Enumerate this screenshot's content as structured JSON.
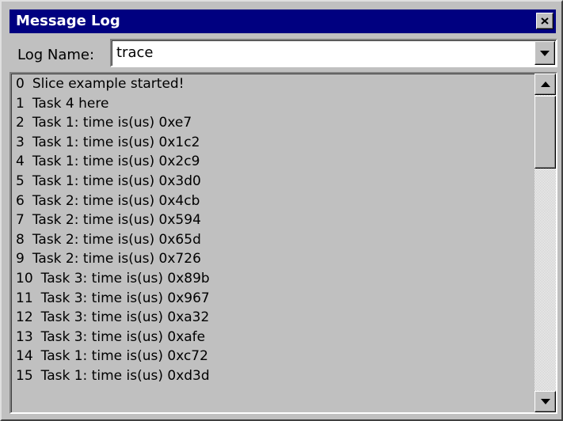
{
  "window": {
    "title": "Message Log"
  },
  "log_name": {
    "label": "Log Name:",
    "value": "trace"
  },
  "messages": [
    {
      "index": "0",
      "text": "Slice example started!"
    },
    {
      "index": "1",
      "text": "Task 4 here"
    },
    {
      "index": "2",
      "text": "Task 1: time is(us) 0xe7"
    },
    {
      "index": "3",
      "text": "Task 1: time is(us) 0x1c2"
    },
    {
      "index": "4",
      "text": "Task 1: time is(us) 0x2c9"
    },
    {
      "index": "5",
      "text": "Task 1: time is(us) 0x3d0"
    },
    {
      "index": "6",
      "text": "Task 2: time is(us) 0x4cb"
    },
    {
      "index": "7",
      "text": "Task 2: time is(us) 0x594"
    },
    {
      "index": "8",
      "text": "Task 2: time is(us) 0x65d"
    },
    {
      "index": "9",
      "text": "Task 2: time is(us) 0x726"
    },
    {
      "index": "10",
      "text": "Task 3: time is(us) 0x89b"
    },
    {
      "index": "11",
      "text": "Task 3: time is(us) 0x967"
    },
    {
      "index": "12",
      "text": "Task 3: time is(us) 0xa32"
    },
    {
      "index": "13",
      "text": "Task 3: time is(us) 0xafe"
    },
    {
      "index": "14",
      "text": "Task 1: time is(us) 0xc72"
    },
    {
      "index": "15",
      "text": "Task 1: time is(us) 0xd3d"
    }
  ],
  "icons": {
    "close": "close-icon",
    "dropdown": "chevron-down-icon",
    "scroll_up": "arrow-up-icon",
    "scroll_down": "arrow-down-icon"
  },
  "colors": {
    "title_bar": "#000080",
    "title_text": "#ffffff",
    "face": "#c0c0c0"
  }
}
